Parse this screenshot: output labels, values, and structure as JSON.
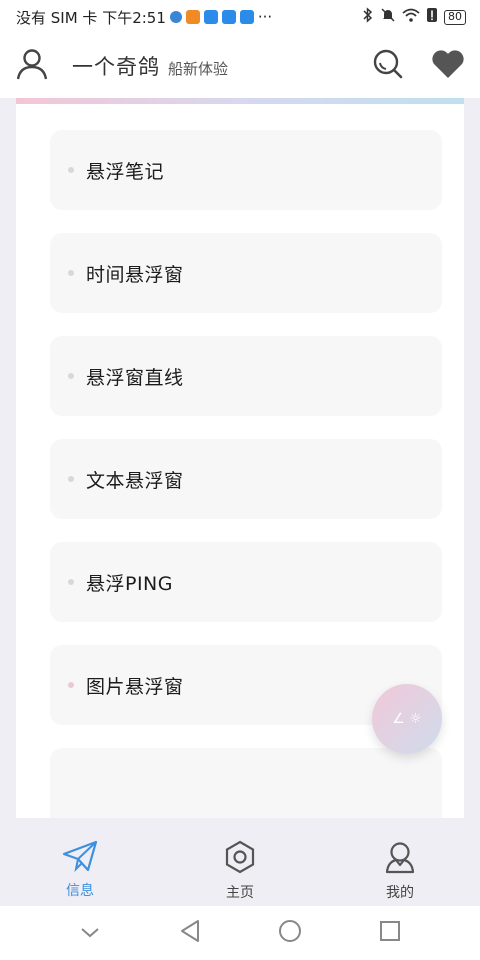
{
  "status_bar": {
    "carrier_text": "没有 SIM 卡 下午2:51",
    "more": "···",
    "battery": "80",
    "app_icon_colors": [
      "#3a86d6",
      "#f08a24",
      "#2a8be8",
      "#2a8be8",
      "#2a8be8"
    ]
  },
  "header": {
    "title": "一个奇鸽",
    "subtitle": "船新体验"
  },
  "list": {
    "items": [
      {
        "label": "悬浮笔记"
      },
      {
        "label": "时间悬浮窗"
      },
      {
        "label": "悬浮窗直线"
      },
      {
        "label": "文本悬浮窗"
      },
      {
        "label": "悬浮PING"
      },
      {
        "label": "图片悬浮窗"
      },
      {
        "label": ""
      }
    ]
  },
  "fab": {
    "label": "∠ ☼"
  },
  "bottom_nav": {
    "items": [
      {
        "label": "信息",
        "icon": "paper-plane-icon",
        "active": true
      },
      {
        "label": "主页",
        "icon": "hexagon-icon",
        "active": false
      },
      {
        "label": "我的",
        "icon": "user-icon",
        "active": false
      }
    ]
  },
  "colors": {
    "accent": "#3d8fe0",
    "content_bg": "#eeeef4",
    "card_bg": "#f7f7f8"
  }
}
